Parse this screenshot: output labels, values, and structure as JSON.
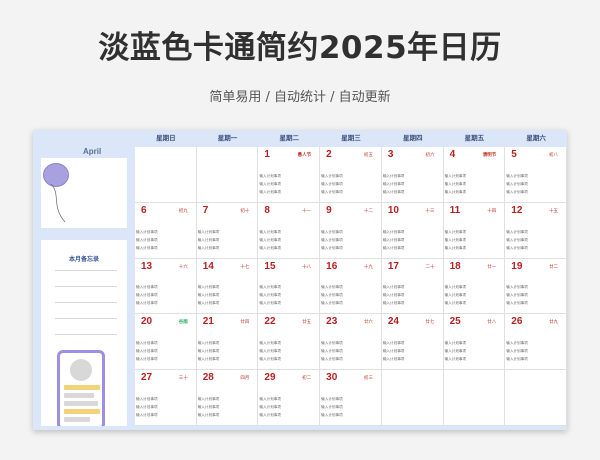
{
  "header": {
    "title": "淡蓝色卡通简约2025年日历",
    "subtitle": "简单易用 / 自动统计 / 自动更新"
  },
  "sidebar": {
    "month": "April",
    "memo_title": "本月备忘录"
  },
  "weekdays": [
    "星期日",
    "星期一",
    "星期二",
    "星期三",
    "星期四",
    "星期五",
    "星期六"
  ],
  "plan_text": "输入计划事项",
  "weeks": [
    [
      {
        "day": "",
        "lunar": ""
      },
      {
        "day": "",
        "lunar": ""
      },
      {
        "day": "1",
        "lunar": "愚人节"
      },
      {
        "day": "2",
        "lunar": "初五"
      },
      {
        "day": "3",
        "lunar": "初六"
      },
      {
        "day": "4",
        "lunar": "清明节"
      },
      {
        "day": "5",
        "lunar": "初八"
      }
    ],
    [
      {
        "day": "6",
        "lunar": "初九"
      },
      {
        "day": "7",
        "lunar": "初十"
      },
      {
        "day": "8",
        "lunar": "十一"
      },
      {
        "day": "9",
        "lunar": "十二"
      },
      {
        "day": "10",
        "lunar": "十三"
      },
      {
        "day": "11",
        "lunar": "十四"
      },
      {
        "day": "12",
        "lunar": "十五"
      }
    ],
    [
      {
        "day": "13",
        "lunar": "十六"
      },
      {
        "day": "14",
        "lunar": "十七"
      },
      {
        "day": "15",
        "lunar": "十八"
      },
      {
        "day": "16",
        "lunar": "十九"
      },
      {
        "day": "17",
        "lunar": "二十"
      },
      {
        "day": "18",
        "lunar": "廿一"
      },
      {
        "day": "19",
        "lunar": "廿二"
      }
    ],
    [
      {
        "day": "20",
        "lunar": "谷雨"
      },
      {
        "day": "21",
        "lunar": "廿四"
      },
      {
        "day": "22",
        "lunar": "廿五"
      },
      {
        "day": "23",
        "lunar": "廿六"
      },
      {
        "day": "24",
        "lunar": "廿七"
      },
      {
        "day": "25",
        "lunar": "廿八"
      },
      {
        "day": "26",
        "lunar": "廿九"
      }
    ],
    [
      {
        "day": "27",
        "lunar": "三十"
      },
      {
        "day": "28",
        "lunar": "四月"
      },
      {
        "day": "29",
        "lunar": "初二"
      },
      {
        "day": "30",
        "lunar": "初三"
      },
      {
        "day": "",
        "lunar": ""
      },
      {
        "day": "",
        "lunar": ""
      },
      {
        "day": "",
        "lunar": ""
      }
    ]
  ],
  "colors": {
    "accent": "#dbe7f8",
    "day_number": "#b8201f",
    "holiday": "#c0392b",
    "solar_term": "#27ae60",
    "balloon": "#a9a0df",
    "phone_frame": "#a08ee0",
    "phone_bar": "#f3d27a"
  },
  "icons": {
    "balloon": "balloon-icon",
    "phone": "phone-illustration"
  }
}
